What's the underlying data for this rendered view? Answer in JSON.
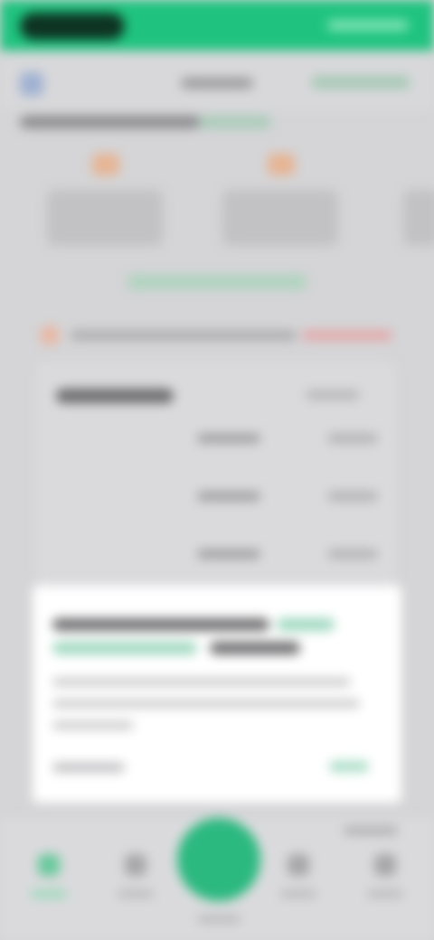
{
  "screen": {
    "description_visible_text": [],
    "colors": {
      "status_bar": "#1fc37f",
      "accent_green": "#2cb980",
      "alert_red": "#e4a3a4",
      "dialog_bg": "#ffffff",
      "page_bg": "#d5d5d7"
    }
  },
  "status_bar": {
    "left_pill_text": "",
    "right_text": ""
  },
  "header": {
    "left_icon": "profile-icon",
    "title": "",
    "right_link": ""
  },
  "carousel": [
    {
      "icon": "gift-icon",
      "label": ""
    },
    {
      "icon": "gift-icon",
      "label": ""
    },
    {
      "icon": "gift-icon",
      "label": ""
    }
  ],
  "link_text": "",
  "alert": {
    "icon": "warning-icon",
    "text": "",
    "highlight": ""
  },
  "panel": {
    "title": "",
    "right_label": "",
    "rows": [
      {
        "a": "",
        "b": ""
      },
      {
        "a": "",
        "b": ""
      },
      {
        "a": "",
        "b": ""
      }
    ]
  },
  "dialog": {
    "title_parts": [
      "",
      "",
      "",
      ""
    ],
    "body_lines": [
      "",
      "",
      ""
    ],
    "footer_left": "",
    "footer_right": ""
  },
  "bottom_nav": {
    "items": [
      {
        "icon": "home-icon",
        "label": ""
      },
      {
        "icon": "chart-icon",
        "label": ""
      },
      {
        "icon": "trade-icon",
        "label": ""
      },
      {
        "icon": "list-icon",
        "label": ""
      },
      {
        "icon": "wallet-icon",
        "label": ""
      }
    ],
    "top_right": ""
  }
}
